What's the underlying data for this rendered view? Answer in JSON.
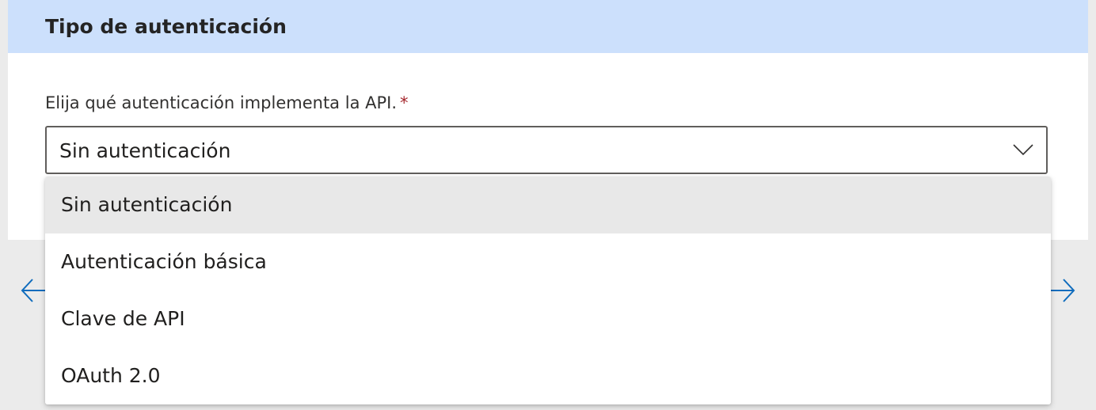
{
  "section": {
    "title": "Tipo de autenticación"
  },
  "auth_field": {
    "label": "Elija qué autenticación implementa la API.",
    "required_marker": "*",
    "selected_value": "Sin autenticación"
  },
  "dropdown": {
    "options": [
      {
        "label": "Sin autenticación",
        "selected": true
      },
      {
        "label": "Autenticación básica",
        "selected": false
      },
      {
        "label": "Clave de API",
        "selected": false
      },
      {
        "label": "OAuth 2.0",
        "selected": false
      }
    ]
  },
  "icons": {
    "chevron": "chevron-down-icon",
    "back": "arrow-left-icon",
    "forward": "arrow-right-icon"
  },
  "colors": {
    "header_background": "#cce0fc",
    "accent": "#0f6cbd",
    "required": "#a4262c",
    "selected_option_background": "#e8e8e8"
  }
}
